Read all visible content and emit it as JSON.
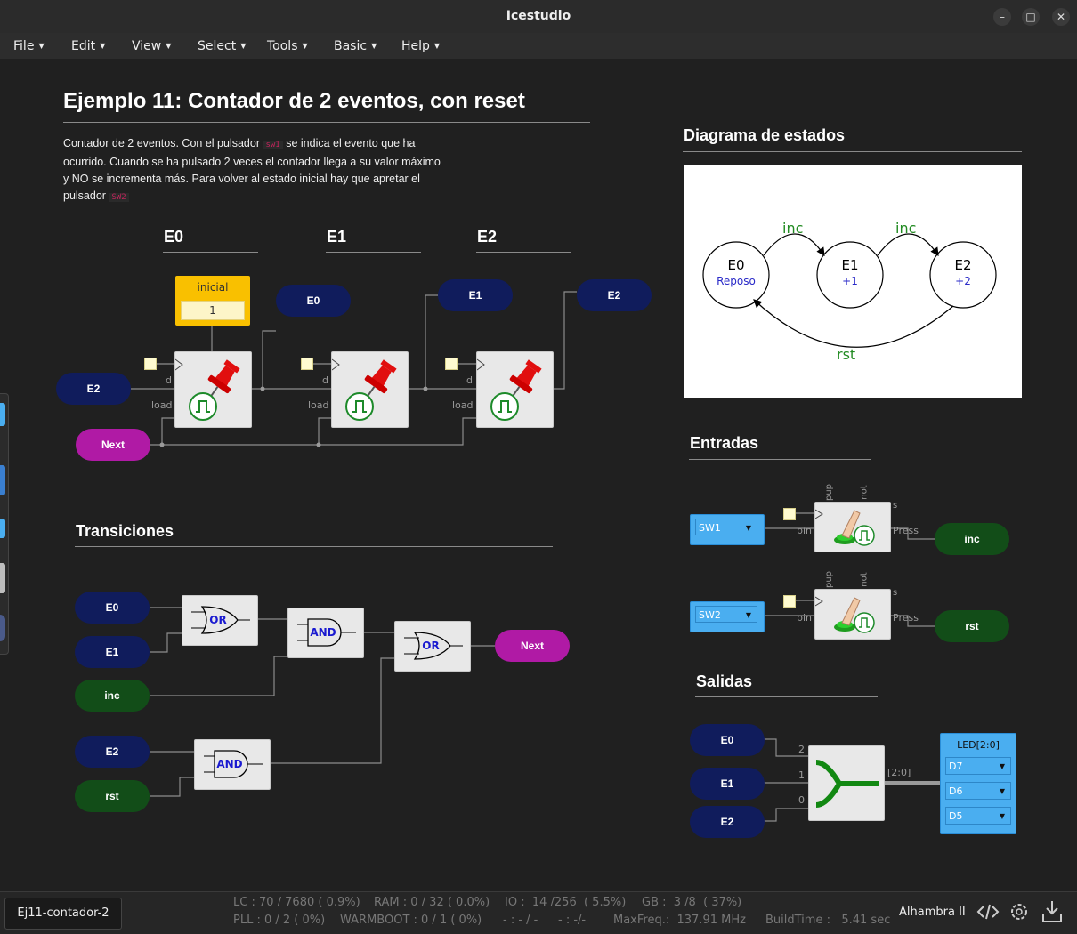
{
  "window": {
    "title": "Icestudio"
  },
  "menu": [
    "File",
    "Edit",
    "View",
    "Select",
    "Tools",
    "Basic",
    "Help"
  ],
  "main": {
    "title": "Ejemplo 11: Contador de 2 eventos, con reset",
    "description": {
      "p1": "Contador de 2 eventos. Con el pulsador",
      "code1": "sw1",
      "p2": "se indica el evento que ha ocurrido. Cuando se ha pulsado 2 veces el contador llega a su valor máximo y NO se incrementa más. Para volver al estado inicial hay que apretar el pulsador",
      "code2": "SW2"
    },
    "state_headers": [
      "E0",
      "E1",
      "E2"
    ],
    "initial_const": {
      "label": "inicial",
      "value": "1"
    },
    "port_labels": {
      "d": "d",
      "load": "load"
    },
    "counter_pills": {
      "in_e2": "E2",
      "next": "Next",
      "out_e0": "E0",
      "out_e1": "E1",
      "out_e2": "E2"
    }
  },
  "diagram": {
    "title": "Diagrama de estados",
    "states": [
      {
        "name": "E0",
        "sub": "Reposo"
      },
      {
        "name": "E1",
        "sub": "+1"
      },
      {
        "name": "E2",
        "sub": "+2"
      }
    ],
    "transitions": {
      "inc1": "inc",
      "inc2": "inc",
      "rst": "rst"
    },
    "colors": {
      "transition": "#228b22",
      "substate": "#2a2ac8"
    }
  },
  "transiciones": {
    "title": "Transiciones",
    "pills": {
      "e0": "E0",
      "e1": "E1",
      "inc": "inc",
      "e2": "E2",
      "rst": "rst",
      "next": "Next"
    },
    "gates": {
      "or1": "OR",
      "and1": "AND",
      "or2": "OR",
      "and2": "AND"
    }
  },
  "entradas": {
    "title": "Entradas",
    "rows": [
      {
        "pin": "SW1",
        "output": "inc"
      },
      {
        "pin": "SW2",
        "output": "rst"
      }
    ],
    "labels": {
      "pup": "pup",
      "not": "not",
      "s": "s",
      "pin": "pin",
      "press": "Press"
    }
  },
  "salidas": {
    "title": "Salidas",
    "inputs": [
      "E0",
      "E1",
      "E2"
    ],
    "bits": [
      "2",
      "1",
      "0"
    ],
    "bus_label": "[2:0]",
    "led": {
      "title": "LED[2:0]",
      "pins": [
        "D7",
        "D6",
        "D5"
      ]
    }
  },
  "status": {
    "project": "Ej11-contador-2",
    "lc": "LC : 70 / 7680 ( 0.9%)",
    "ram": "RAM : 0 / 32 ( 0.0%)",
    "io": "IO :  14 /256  ( 5.5%)",
    "gb": "GB :  3 /8  ( 37%)",
    "pll": "PLL : 0 / 2 ( 0%)",
    "warmboot": "WARMBOOT : 0 / 1 ( 0%)",
    "blank1": "- : - / -",
    "blank2": "- : -/-",
    "maxfreq": "MaxFreq.:  137.91 MHz",
    "buildtime": "BuildTime :   5.41 sec",
    "board": "Alhambra II"
  },
  "colors": {
    "bg": "#1e1e1e",
    "navy": "#101c5c",
    "green": "#124d18",
    "purple": "#b01aa5",
    "const": "#f9c000",
    "input_blue": "#4aaef0"
  }
}
